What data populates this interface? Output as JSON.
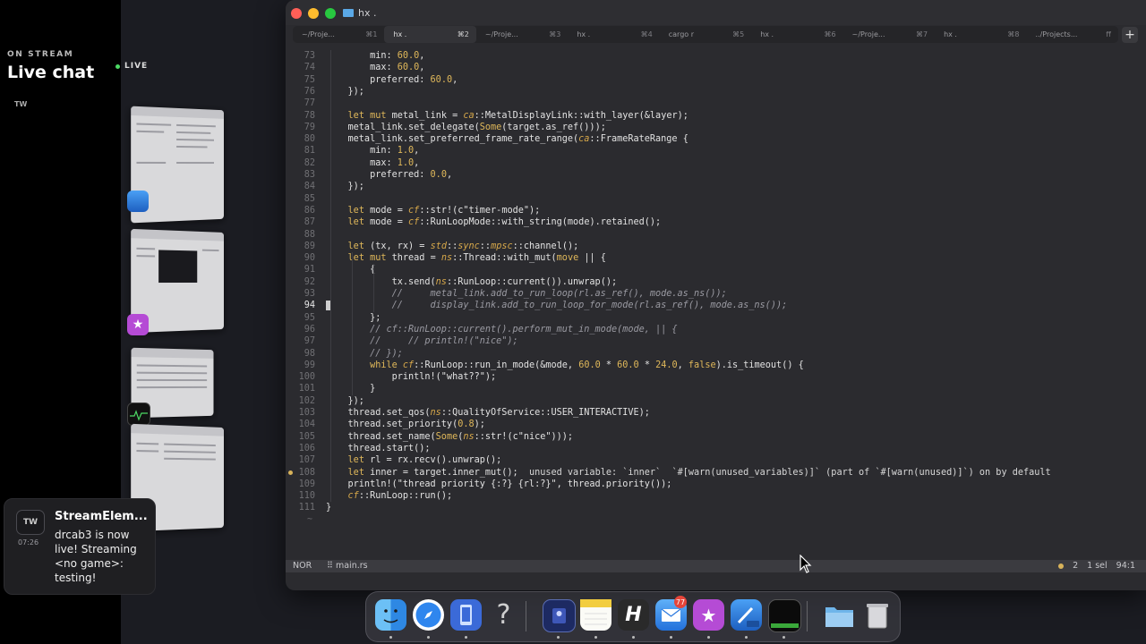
{
  "overlay": {
    "on_stream": "ON STREAM",
    "title": "Live chat",
    "tw_label": "TW",
    "live_label": "LIVE"
  },
  "notification": {
    "badge": "TW",
    "time": "07:26",
    "title": "StreamElem...",
    "body": "drcab3 is now live! Streaming <no game>: testing!"
  },
  "window": {
    "title": "hx .",
    "tabs": [
      {
        "label": "~/Proje...",
        "shortcut": "⌘1",
        "active": false
      },
      {
        "label": "hx .",
        "shortcut": "⌘2",
        "active": true
      },
      {
        "label": "~/Proje...",
        "shortcut": "⌘3",
        "active": false
      },
      {
        "label": "hx .",
        "shortcut": "⌘4",
        "active": false
      },
      {
        "label": "cargo r",
        "shortcut": "⌘5",
        "active": false
      },
      {
        "label": "hx .",
        "shortcut": "⌘6",
        "active": false
      },
      {
        "label": "~/Proje...",
        "shortcut": "⌘7",
        "active": false
      },
      {
        "label": "hx .",
        "shortcut": "⌘8",
        "active": false
      },
      {
        "label": "../Projects...",
        "shortcut": "ff",
        "active": false
      }
    ],
    "add_tab": "+"
  },
  "code": {
    "current_line": 94,
    "lines": [
      {
        "n": 73,
        "text": "        min: 60.0,"
      },
      {
        "n": 74,
        "text": "        max: 60.0,"
      },
      {
        "n": 75,
        "text": "        preferred: 60.0,"
      },
      {
        "n": 76,
        "text": "    });"
      },
      {
        "n": 77,
        "text": ""
      },
      {
        "n": 78,
        "text": "    let mut metal_link = ca::MetalDisplayLink::with_layer(&layer);"
      },
      {
        "n": 79,
        "text": "    metal_link.set_delegate(Some(target.as_ref()));"
      },
      {
        "n": 80,
        "text": "    metal_link.set_preferred_frame_rate_range(ca::FrameRateRange {"
      },
      {
        "n": 81,
        "text": "        min: 1.0,"
      },
      {
        "n": 82,
        "text": "        max: 1.0,"
      },
      {
        "n": 83,
        "text": "        preferred: 0.0,"
      },
      {
        "n": 84,
        "text": "    });"
      },
      {
        "n": 85,
        "text": ""
      },
      {
        "n": 86,
        "text": "    let mode = cf::str!(c\"timer-mode\");"
      },
      {
        "n": 87,
        "text": "    let mode = cf::RunLoopMode::with_string(mode).retained();"
      },
      {
        "n": 88,
        "text": ""
      },
      {
        "n": 89,
        "text": "    let (tx, rx) = std::sync::mpsc::channel();"
      },
      {
        "n": 90,
        "text": "    let mut thread = ns::Thread::with_mut(move || {"
      },
      {
        "n": 91,
        "text": "        {"
      },
      {
        "n": 92,
        "text": "            tx.send(ns::RunLoop::current()).unwrap();"
      },
      {
        "n": 93,
        "text": "            //     metal_link.add_to_run_loop(rl.as_ref(), mode.as_ns());"
      },
      {
        "n": 94,
        "text": "            //     display_link.add_to_run_loop_for_mode(rl.as_ref(), mode.as_ns());"
      },
      {
        "n": 95,
        "text": "        };"
      },
      {
        "n": 96,
        "text": "        // cf::RunLoop::current().perform_mut_in_mode(mode, || {"
      },
      {
        "n": 97,
        "text": "        //     // println!(\"nice\");"
      },
      {
        "n": 98,
        "text": "        // });"
      },
      {
        "n": 99,
        "text": "        while cf::RunLoop::run_in_mode(&mode, 60.0 * 60.0 * 24.0, false).is_timeout() {"
      },
      {
        "n": 100,
        "text": "            println!(\"what??\");"
      },
      {
        "n": 101,
        "text": "        }"
      },
      {
        "n": 102,
        "text": "    });"
      },
      {
        "n": 103,
        "text": "    thread.set_qos(ns::QualityOfService::USER_INTERACTIVE);"
      },
      {
        "n": 104,
        "text": "    thread.set_priority(0.8);"
      },
      {
        "n": 105,
        "text": "    thread.set_name(Some(ns::str!(c\"nice\")));"
      },
      {
        "n": 106,
        "text": "    thread.start();"
      },
      {
        "n": 107,
        "text": "    let rl = rx.recv().unwrap();"
      },
      {
        "n": 108,
        "text": "    let inner = target.inner_mut();  unused variable: `inner`  `#[warn(unused_variables)]` (part of `#[warn(unused)]`) on by default"
      },
      {
        "n": 109,
        "text": "    println!(\"thread priority {:?} {rl:?}\", thread.priority());"
      },
      {
        "n": 110,
        "text": "    cf::RunLoop::run();"
      },
      {
        "n": 111,
        "text": "}"
      }
    ],
    "eof_marker": "~"
  },
  "statusbar": {
    "mode": "NOR",
    "file": "⠿ main.rs",
    "diagnostics": "2",
    "selection": "1 sel",
    "position": "94:1"
  },
  "dock": {
    "apps": [
      {
        "name": "Finder",
        "icon": "finder-icon",
        "color": "#3ea0f0"
      },
      {
        "name": "Safari",
        "icon": "safari-icon",
        "color": "#3d8ef0"
      },
      {
        "name": "Simulator",
        "icon": "simulator-icon",
        "color": "#4a7de0"
      },
      {
        "name": "Unknown",
        "icon": "question-icon",
        "glyph": "?"
      },
      {
        "name": "Xcode Window",
        "icon": "blue-app-icon",
        "color": "#2e3f8f"
      },
      {
        "name": "Notes",
        "icon": "notes-icon",
        "color": "#f2d04a"
      },
      {
        "name": "Helix",
        "icon": "h-icon",
        "glyph": "H"
      },
      {
        "name": "Mail",
        "icon": "mail-icon",
        "color": "#3f8de8",
        "badge": "77"
      },
      {
        "name": "Feedback",
        "icon": "star-icon",
        "color": "#b64bd6"
      },
      {
        "name": "Xcode Beta",
        "icon": "xcode-beta-icon",
        "color": "#2f7ee0"
      },
      {
        "name": "Activity Monitor",
        "icon": "activity-monitor-icon"
      },
      {
        "name": "Downloads",
        "icon": "folder-icon",
        "color": "#6fb5ea"
      },
      {
        "name": "Trash",
        "icon": "trash-icon"
      }
    ]
  },
  "colors": {
    "keyword": "#e0b85a",
    "comment": "#9a9aa2",
    "diagnostic": "#d8b35a",
    "live": "#4cd964"
  }
}
